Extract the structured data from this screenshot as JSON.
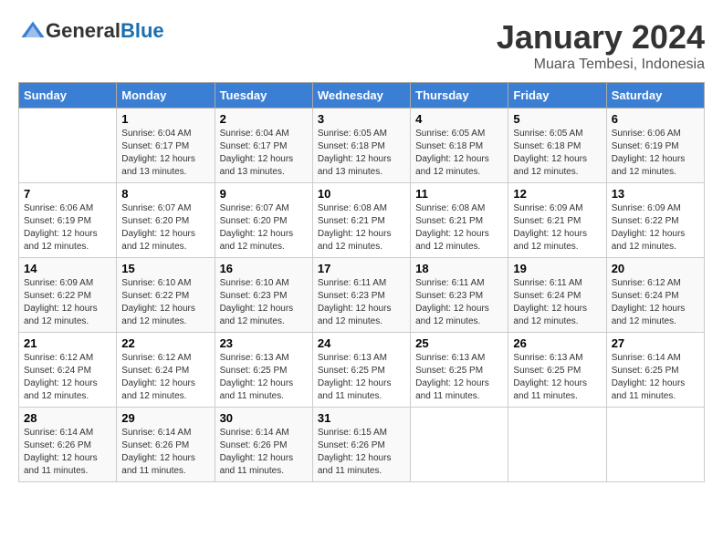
{
  "header": {
    "logo_general": "General",
    "logo_blue": "Blue",
    "month_title": "January 2024",
    "location": "Muara Tembesi, Indonesia"
  },
  "days_of_week": [
    "Sunday",
    "Monday",
    "Tuesday",
    "Wednesday",
    "Thursday",
    "Friday",
    "Saturday"
  ],
  "weeks": [
    [
      {
        "day": "",
        "sunrise": "",
        "sunset": "",
        "daylight": ""
      },
      {
        "day": "1",
        "sunrise": "Sunrise: 6:04 AM",
        "sunset": "Sunset: 6:17 PM",
        "daylight": "Daylight: 12 hours and 13 minutes."
      },
      {
        "day": "2",
        "sunrise": "Sunrise: 6:04 AM",
        "sunset": "Sunset: 6:17 PM",
        "daylight": "Daylight: 12 hours and 13 minutes."
      },
      {
        "day": "3",
        "sunrise": "Sunrise: 6:05 AM",
        "sunset": "Sunset: 6:18 PM",
        "daylight": "Daylight: 12 hours and 13 minutes."
      },
      {
        "day": "4",
        "sunrise": "Sunrise: 6:05 AM",
        "sunset": "Sunset: 6:18 PM",
        "daylight": "Daylight: 12 hours and 12 minutes."
      },
      {
        "day": "5",
        "sunrise": "Sunrise: 6:05 AM",
        "sunset": "Sunset: 6:18 PM",
        "daylight": "Daylight: 12 hours and 12 minutes."
      },
      {
        "day": "6",
        "sunrise": "Sunrise: 6:06 AM",
        "sunset": "Sunset: 6:19 PM",
        "daylight": "Daylight: 12 hours and 12 minutes."
      }
    ],
    [
      {
        "day": "7",
        "sunrise": "Sunrise: 6:06 AM",
        "sunset": "Sunset: 6:19 PM",
        "daylight": "Daylight: 12 hours and 12 minutes."
      },
      {
        "day": "8",
        "sunrise": "Sunrise: 6:07 AM",
        "sunset": "Sunset: 6:20 PM",
        "daylight": "Daylight: 12 hours and 12 minutes."
      },
      {
        "day": "9",
        "sunrise": "Sunrise: 6:07 AM",
        "sunset": "Sunset: 6:20 PM",
        "daylight": "Daylight: 12 hours and 12 minutes."
      },
      {
        "day": "10",
        "sunrise": "Sunrise: 6:08 AM",
        "sunset": "Sunset: 6:21 PM",
        "daylight": "Daylight: 12 hours and 12 minutes."
      },
      {
        "day": "11",
        "sunrise": "Sunrise: 6:08 AM",
        "sunset": "Sunset: 6:21 PM",
        "daylight": "Daylight: 12 hours and 12 minutes."
      },
      {
        "day": "12",
        "sunrise": "Sunrise: 6:09 AM",
        "sunset": "Sunset: 6:21 PM",
        "daylight": "Daylight: 12 hours and 12 minutes."
      },
      {
        "day": "13",
        "sunrise": "Sunrise: 6:09 AM",
        "sunset": "Sunset: 6:22 PM",
        "daylight": "Daylight: 12 hours and 12 minutes."
      }
    ],
    [
      {
        "day": "14",
        "sunrise": "Sunrise: 6:09 AM",
        "sunset": "Sunset: 6:22 PM",
        "daylight": "Daylight: 12 hours and 12 minutes."
      },
      {
        "day": "15",
        "sunrise": "Sunrise: 6:10 AM",
        "sunset": "Sunset: 6:22 PM",
        "daylight": "Daylight: 12 hours and 12 minutes."
      },
      {
        "day": "16",
        "sunrise": "Sunrise: 6:10 AM",
        "sunset": "Sunset: 6:23 PM",
        "daylight": "Daylight: 12 hours and 12 minutes."
      },
      {
        "day": "17",
        "sunrise": "Sunrise: 6:11 AM",
        "sunset": "Sunset: 6:23 PM",
        "daylight": "Daylight: 12 hours and 12 minutes."
      },
      {
        "day": "18",
        "sunrise": "Sunrise: 6:11 AM",
        "sunset": "Sunset: 6:23 PM",
        "daylight": "Daylight: 12 hours and 12 minutes."
      },
      {
        "day": "19",
        "sunrise": "Sunrise: 6:11 AM",
        "sunset": "Sunset: 6:24 PM",
        "daylight": "Daylight: 12 hours and 12 minutes."
      },
      {
        "day": "20",
        "sunrise": "Sunrise: 6:12 AM",
        "sunset": "Sunset: 6:24 PM",
        "daylight": "Daylight: 12 hours and 12 minutes."
      }
    ],
    [
      {
        "day": "21",
        "sunrise": "Sunrise: 6:12 AM",
        "sunset": "Sunset: 6:24 PM",
        "daylight": "Daylight: 12 hours and 12 minutes."
      },
      {
        "day": "22",
        "sunrise": "Sunrise: 6:12 AM",
        "sunset": "Sunset: 6:24 PM",
        "daylight": "Daylight: 12 hours and 12 minutes."
      },
      {
        "day": "23",
        "sunrise": "Sunrise: 6:13 AM",
        "sunset": "Sunset: 6:25 PM",
        "daylight": "Daylight: 12 hours and 11 minutes."
      },
      {
        "day": "24",
        "sunrise": "Sunrise: 6:13 AM",
        "sunset": "Sunset: 6:25 PM",
        "daylight": "Daylight: 12 hours and 11 minutes."
      },
      {
        "day": "25",
        "sunrise": "Sunrise: 6:13 AM",
        "sunset": "Sunset: 6:25 PM",
        "daylight": "Daylight: 12 hours and 11 minutes."
      },
      {
        "day": "26",
        "sunrise": "Sunrise: 6:13 AM",
        "sunset": "Sunset: 6:25 PM",
        "daylight": "Daylight: 12 hours and 11 minutes."
      },
      {
        "day": "27",
        "sunrise": "Sunrise: 6:14 AM",
        "sunset": "Sunset: 6:25 PM",
        "daylight": "Daylight: 12 hours and 11 minutes."
      }
    ],
    [
      {
        "day": "28",
        "sunrise": "Sunrise: 6:14 AM",
        "sunset": "Sunset: 6:26 PM",
        "daylight": "Daylight: 12 hours and 11 minutes."
      },
      {
        "day": "29",
        "sunrise": "Sunrise: 6:14 AM",
        "sunset": "Sunset: 6:26 PM",
        "daylight": "Daylight: 12 hours and 11 minutes."
      },
      {
        "day": "30",
        "sunrise": "Sunrise: 6:14 AM",
        "sunset": "Sunset: 6:26 PM",
        "daylight": "Daylight: 12 hours and 11 minutes."
      },
      {
        "day": "31",
        "sunrise": "Sunrise: 6:15 AM",
        "sunset": "Sunset: 6:26 PM",
        "daylight": "Daylight: 12 hours and 11 minutes."
      },
      {
        "day": "",
        "sunrise": "",
        "sunset": "",
        "daylight": ""
      },
      {
        "day": "",
        "sunrise": "",
        "sunset": "",
        "daylight": ""
      },
      {
        "day": "",
        "sunrise": "",
        "sunset": "",
        "daylight": ""
      }
    ]
  ]
}
